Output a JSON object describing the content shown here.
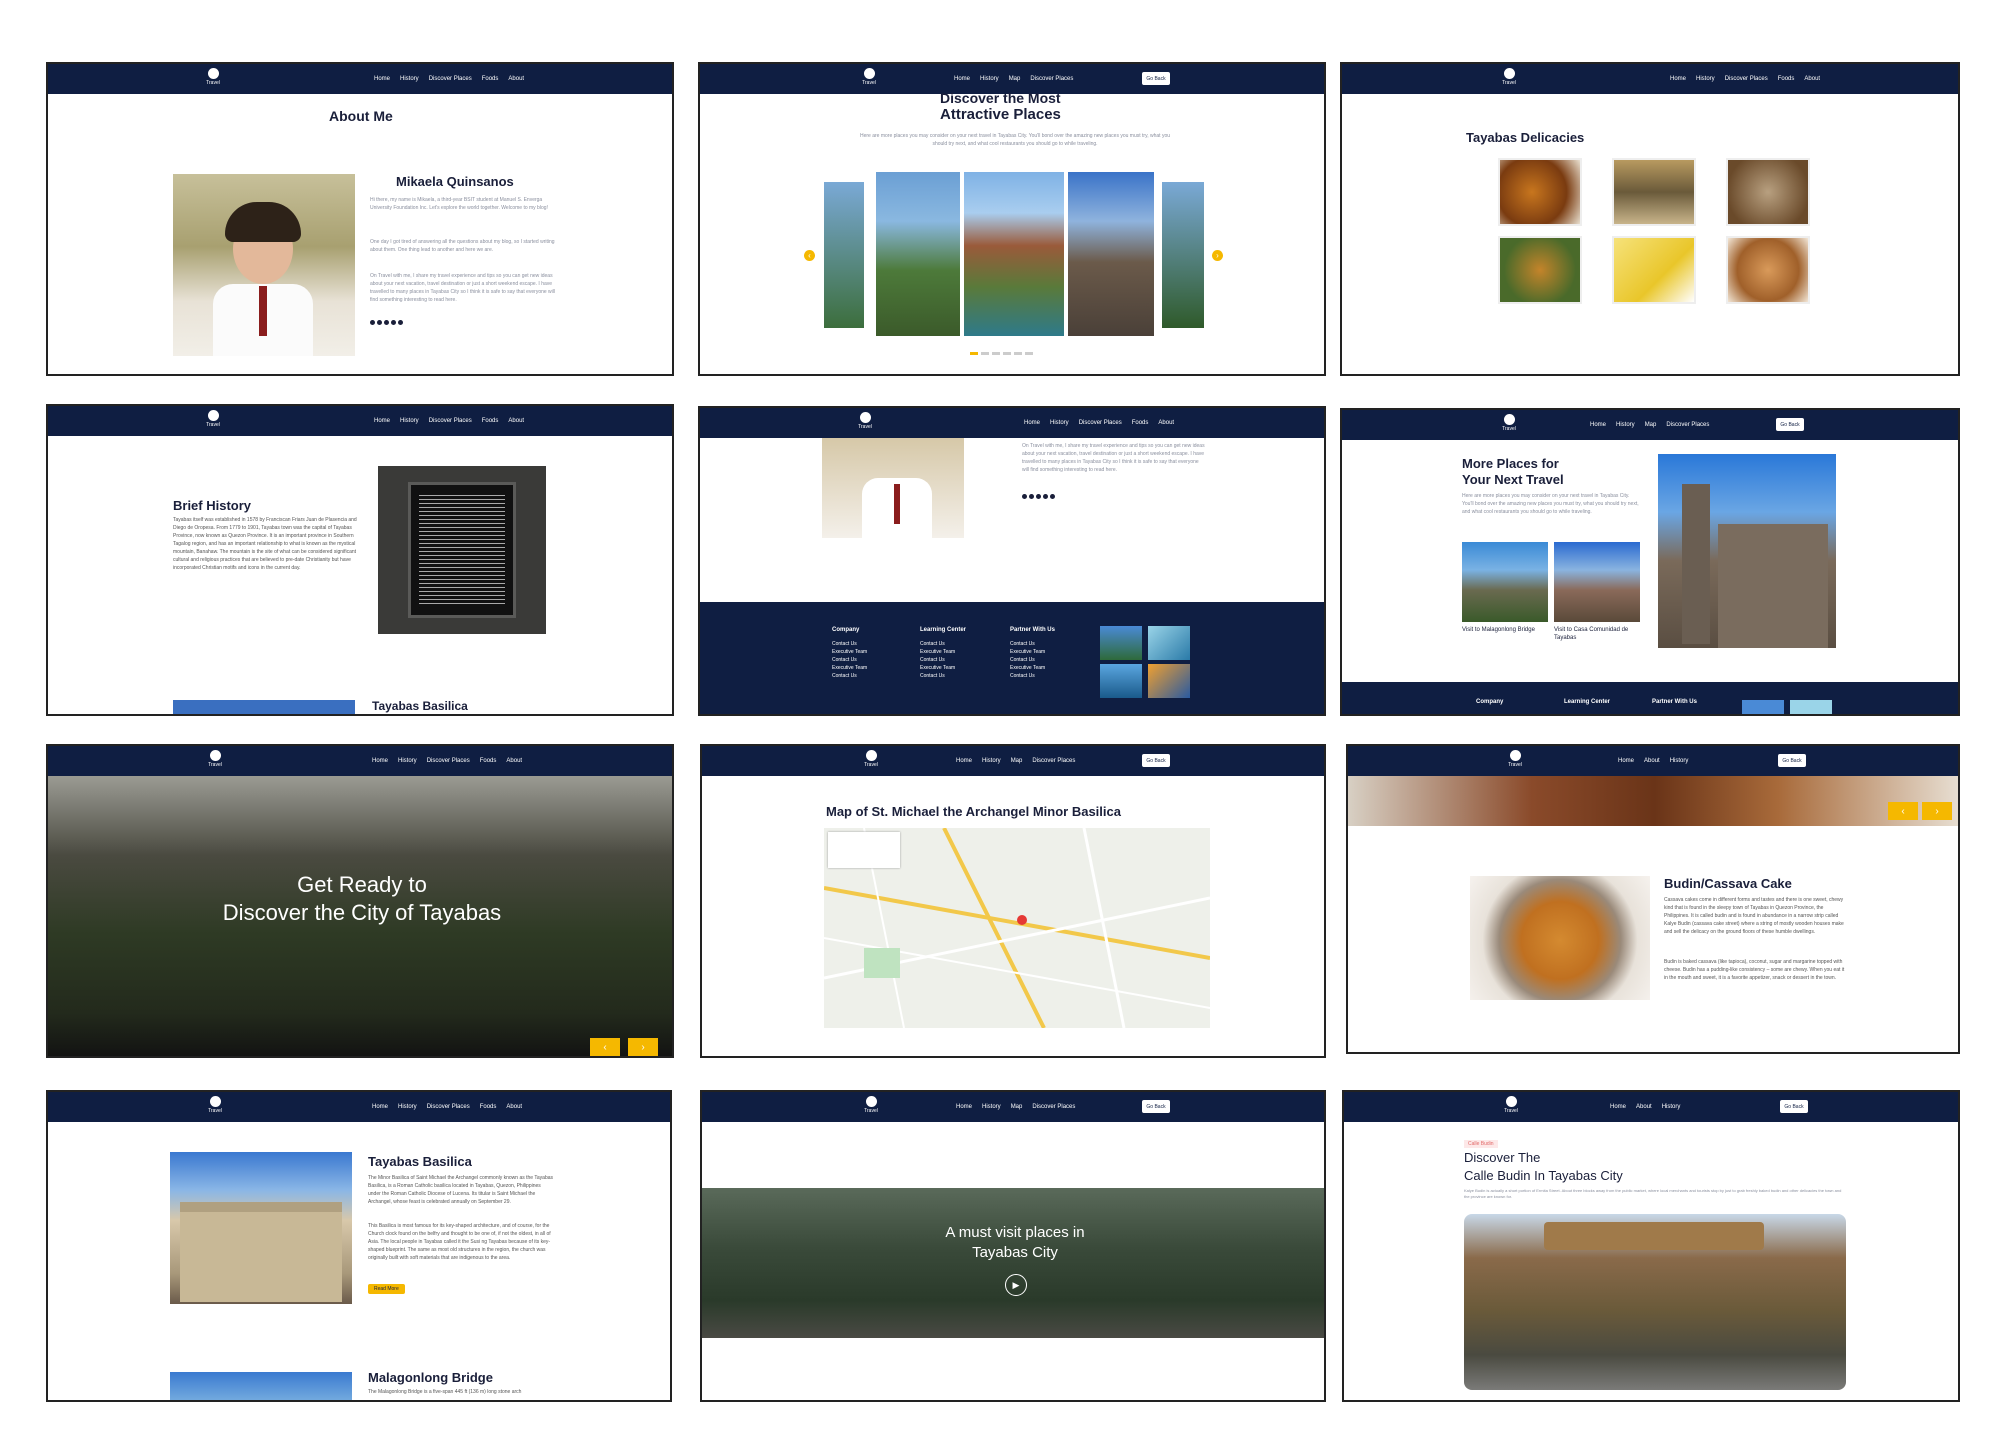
{
  "brand": {
    "logo_text": "Travel"
  },
  "colors": {
    "navy": "#0f1e42",
    "accent": "#f5b800",
    "text": "#1a1f3a"
  },
  "nav_sets": {
    "main": [
      "Home",
      "History",
      "Discover Places",
      "Foods",
      "About"
    ],
    "map": [
      "Home",
      "History",
      "Map",
      "Discover Places"
    ],
    "food": [
      "Home",
      "About",
      "History"
    ]
  },
  "go_back_label": "Go Back",
  "about": {
    "title": "About Me",
    "name": "Mikaela Quinsanos",
    "p1": "Hi there, my name is Mikaela, a third-year BSIT student at Manuel S. Enverga University Foundation Inc. Let's explore the world together. Welcome to my blog!",
    "p2": "One day I got tired of answering all the questions about my blog, so I started writing about them. One thing lead to another and here we are.",
    "p3": "On Travel with me, I share my travel experience and tips so you can get new ideas about your next vacation, travel destination or just a short weekend escape. I have travelled to many places in Tayabas City so I think it is safe to say that everyone will find something interesting to read here."
  },
  "discover": {
    "title_line1": "Discover the Most",
    "title_line2": "Attractive Places",
    "desc": "Here are more places you may consider on your next travel in Tayabas City. You'll bond over the amazing new places you must try, what you should try next, and what cool restaurants you should go to while traveling."
  },
  "delicacies": {
    "title": "Tayabas Delicacies"
  },
  "history": {
    "title": "Brief History",
    "text": "Tayabas itself was established in 1578 by Franciscan Friars Juan de Plasencia and Diego de Oropesa. From 1779 to 1901, Tayabas town was the capital of Tayabas Province, now known as Quezon Province. It is an important province in Southern Tagalog region, and has an important relationship to what is known as the mystical mountain, Banahaw. The mountain is the site of what can be considered significant cultural and religious practices that are believed to pre-date Christianity but have incorporated Christian motifs and icons in the current day.",
    "next_title": "Tayabas Basilica"
  },
  "footer": {
    "cols": [
      {
        "head": "Company",
        "items": [
          "Contact Us",
          "Executive Team",
          "Contact Us",
          "Executive Team",
          "Contact Us"
        ]
      },
      {
        "head": "Learning Center",
        "items": [
          "Contact Us",
          "Executive Team",
          "Contact Us",
          "Executive Team",
          "Contact Us"
        ]
      },
      {
        "head": "Partner With Us",
        "items": [
          "Contact Us",
          "Executive Team",
          "Contact Us",
          "Executive Team",
          "Contact Us"
        ]
      }
    ]
  },
  "more_places": {
    "title_line1": "More Places for",
    "title_line2": "Your Next Travel",
    "desc": "Here are more places you may consider on your next travel in Tayabas City. You'll bond over the amazing new places you must try, what you should try next, and what cool restaurants you should go to while traveling.",
    "cap1": "Visit to Malagonlong Bridge",
    "cap2": "Visit to Casa Comunidad de Tayabas"
  },
  "hero": {
    "line1": "Get Ready to",
    "line2": "Discover the City of Tayabas"
  },
  "map": {
    "title": "Map of St. Michael the Archangel Minor Basilica"
  },
  "budin": {
    "title": "Budin/Cassava Cake",
    "p1": "Cassava cakes come in different forms and tastes and there is one sweet, chewy kind that is found in the sleepy town of Tayabas in Quezon Province, the Philippines. It is called budin and is found in abundance in a narrow strip called Kalye Budin (cassava cake street) where a string of mostly wooden houses make and sell the delicacy on the ground floors of these humble dwellings.",
    "p2": "Budin is baked cassava (like tapioca), coconut, sugar and margarine topped with cheese. Budin has a pudding-like consistency – some are chewy. When you eat it in the mouth and sweet, it is a favorite appetizer, snack or dessert in the town."
  },
  "basilica": {
    "title": "Tayabas Basilica",
    "p1": "The Minor Basilica of Saint Michael the Archangel commonly known as the Tayabas Basilica, is a Roman Catholic basilica located in Tayabas, Quezon, Philippines under the Roman Catholic Diocese of Lucena. Its titular is Saint Michael the Archangel, whose feast is celebrated annually on September 29.",
    "p2": "This Basilica is most famous for its key-shaped architecture, and of course, for the Church clock found on the belfry and thought to be one of, if not the oldest, in all of Asia. The local people in Tayabas called it the Susi ng Tayabas because of its key-shaped blueprint. The same as most old structures in the region, the church was originally built with soft materials that are indigenous to the area.",
    "button": "Read More",
    "next_title": "Malagonlong Bridge",
    "next_text": "The Malagonlong Bridge is a five-span 445 ft (136 m) long stone arch"
  },
  "video": {
    "line1": "A must visit places in",
    "line2": "Tayabas City"
  },
  "calle": {
    "tag": "Calle Budin",
    "title_line1": "Discover The",
    "title_line2": "Calle Budin In Tayabas City",
    "desc": "Kalye Budin is actually a short portion of Ermita Street. About three blocks away from the public market, where local merchants and tourists stop by just to grab freshly baked budin and other delicacies the town and the province are known for."
  }
}
